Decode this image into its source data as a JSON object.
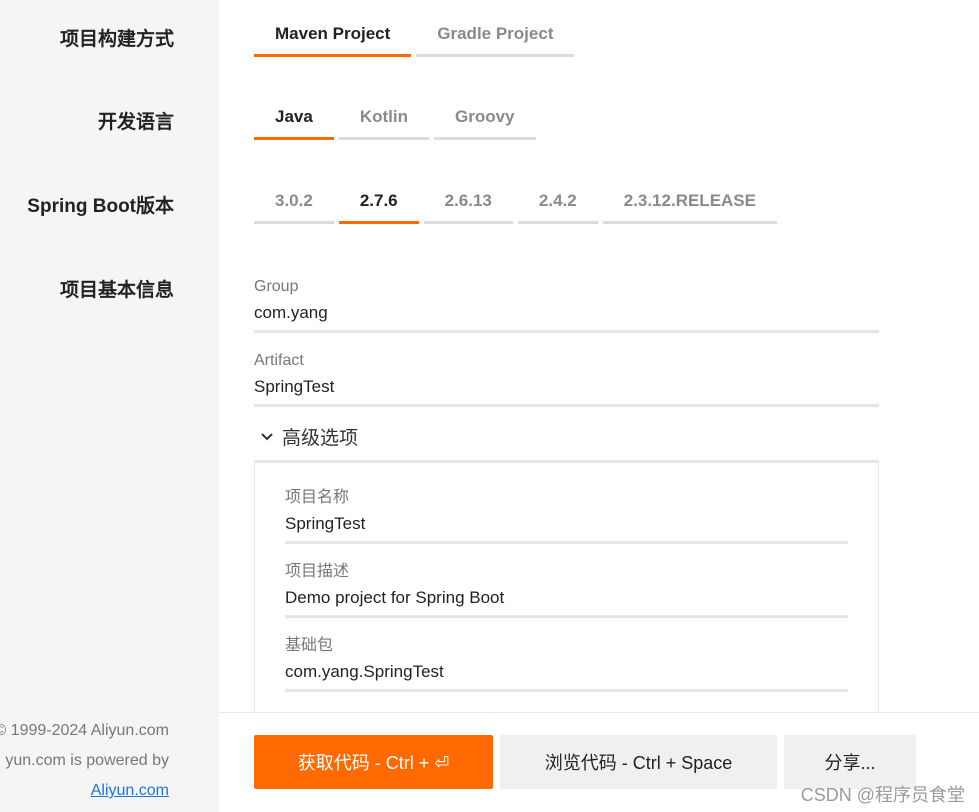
{
  "labels": {
    "build_type": "项目构建方式",
    "language": "开发语言",
    "boot_version": "Spring Boot版本",
    "basic_info": "项目基本信息"
  },
  "build_tabs": [
    "Maven Project",
    "Gradle Project"
  ],
  "build_selected": "Maven Project",
  "language_tabs": [
    "Java",
    "Kotlin",
    "Groovy"
  ],
  "language_selected": "Java",
  "version_tabs": [
    "3.0.2",
    "2.7.6",
    "2.6.13",
    "2.4.2",
    "2.3.12.RELEASE"
  ],
  "version_selected": "2.7.6",
  "fields": {
    "group": {
      "label": "Group",
      "value": "com.yang"
    },
    "artifact": {
      "label": "Artifact",
      "value": "SpringTest"
    }
  },
  "advanced": {
    "toggle_label": "高级选项",
    "project_name": {
      "label": "项目名称",
      "value": "SpringTest"
    },
    "description": {
      "label": "项目描述",
      "value": "Demo project for Spring Boot"
    },
    "base_package": {
      "label": "基础包",
      "value": "com.yang.SpringTest"
    }
  },
  "footer": {
    "copyright": "© 1999-2024 Aliyun.com",
    "powered": "yun.com is powered by",
    "link": "Aliyun.com"
  },
  "buttons": {
    "get_code": "获取代码 - Ctrl + ⏎",
    "browse_code": "浏览代码 - Ctrl + Space",
    "share": "分享..."
  },
  "watermark": "CSDN @程序员食堂",
  "colors": {
    "accent": "#ff6a00",
    "link": "#1a73e8"
  }
}
